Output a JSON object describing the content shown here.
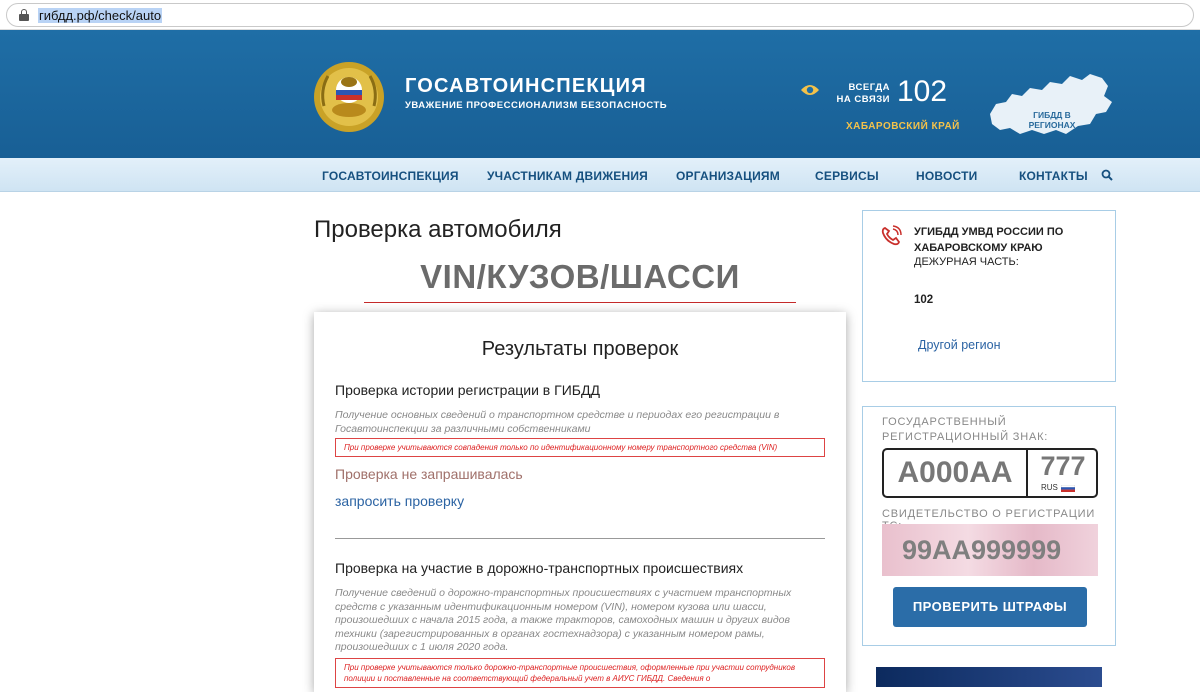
{
  "browser": {
    "url": "гибдд.рф/check/auto"
  },
  "header": {
    "title": "ГОСАВТОИНСПЕКЦИЯ",
    "subtitle": "УВАЖЕНИЕ ПРОФЕССИОНАЛИЗМ БЕЗОПАСНОСТЬ",
    "hotline_label_line1": "ВСЕГДА",
    "hotline_label_line2": "НА СВЯЗИ",
    "hotline_number": "102",
    "region": "ХАБАРОВСКИЙ КРАЙ",
    "map_label": "ГИБДД В РЕГИОНАХ"
  },
  "nav": {
    "items": [
      {
        "label": "ГОСАВТОИНСПЕКЦИЯ"
      },
      {
        "label": "УЧАСТНИКАМ ДВИЖЕНИЯ"
      },
      {
        "label": "ОРГАНИЗАЦИЯМ"
      },
      {
        "label": "СЕРВИСЫ"
      },
      {
        "label": "НОВОСТИ"
      },
      {
        "label": "КОНТАКТЫ"
      }
    ]
  },
  "main": {
    "page_title": "Проверка автомобиля",
    "vin_title": "VIN/КУЗОВ/ШАССИ",
    "results_title": "Результаты проверок",
    "sections": [
      {
        "title": "Проверка истории регистрации в ГИБДД",
        "description": "Получение основных сведений о транспортном средстве и периодах его регистрации в Госавтоинспекции за различными собственниками",
        "note": "При проверке учитываются совпадения только по идентификационному номеру транспортного средства (VIN)",
        "status": "Проверка не запрашивалась",
        "action": "запросить проверку"
      },
      {
        "title": "Проверка на участие в дорожно-транспортных происшествиях",
        "description": "Получение сведений о дорожно-транспортных происшествиях с участием транспортных средств с указанным идентификационным номером (VIN), номером кузова или шасси, произошедших с начала 2015 года, а также тракторов, самоходных машин и других видов техники (зарегистрированных в органах гостехнадзора) с указанным номером рамы, произошедших с 1 июля 2020 года.",
        "note": "При проверке учитываются только дорожно-транспортные происшествия, оформленные при участии сотрудников полиции и поставленные на соответствующий федеральный учет в АИУС ГИБДД. Сведения о"
      }
    ]
  },
  "sidebar": {
    "contact": {
      "org": "УГИБДД УМВД РОССИИ ПО ХАБАРОВСКОМУ КРАЮ",
      "duty": "ДЕЖУРНАЯ ЧАСТЬ:",
      "phone": "102",
      "other_region": "Другой регион"
    },
    "plate": {
      "label": "ГОСУДАРСТВЕННЫЙ РЕГИСТРАЦИОННЫЙ ЗНАК:",
      "number": "А000АА",
      "region": "777",
      "country": "RUS",
      "reg_label": "СВИДЕТЕЛЬСТВО О РЕГИСТРАЦИИ ТС:",
      "reg_number": "99АА999999",
      "button": "ПРОВЕРИТЬ ШТРАФЫ"
    }
  },
  "colors": {
    "header_blue": "#1f6ea6",
    "nav_text": "#16507f",
    "link_blue": "#2b63a3",
    "note_red": "#dd2222",
    "gold": "#f4c24a"
  }
}
